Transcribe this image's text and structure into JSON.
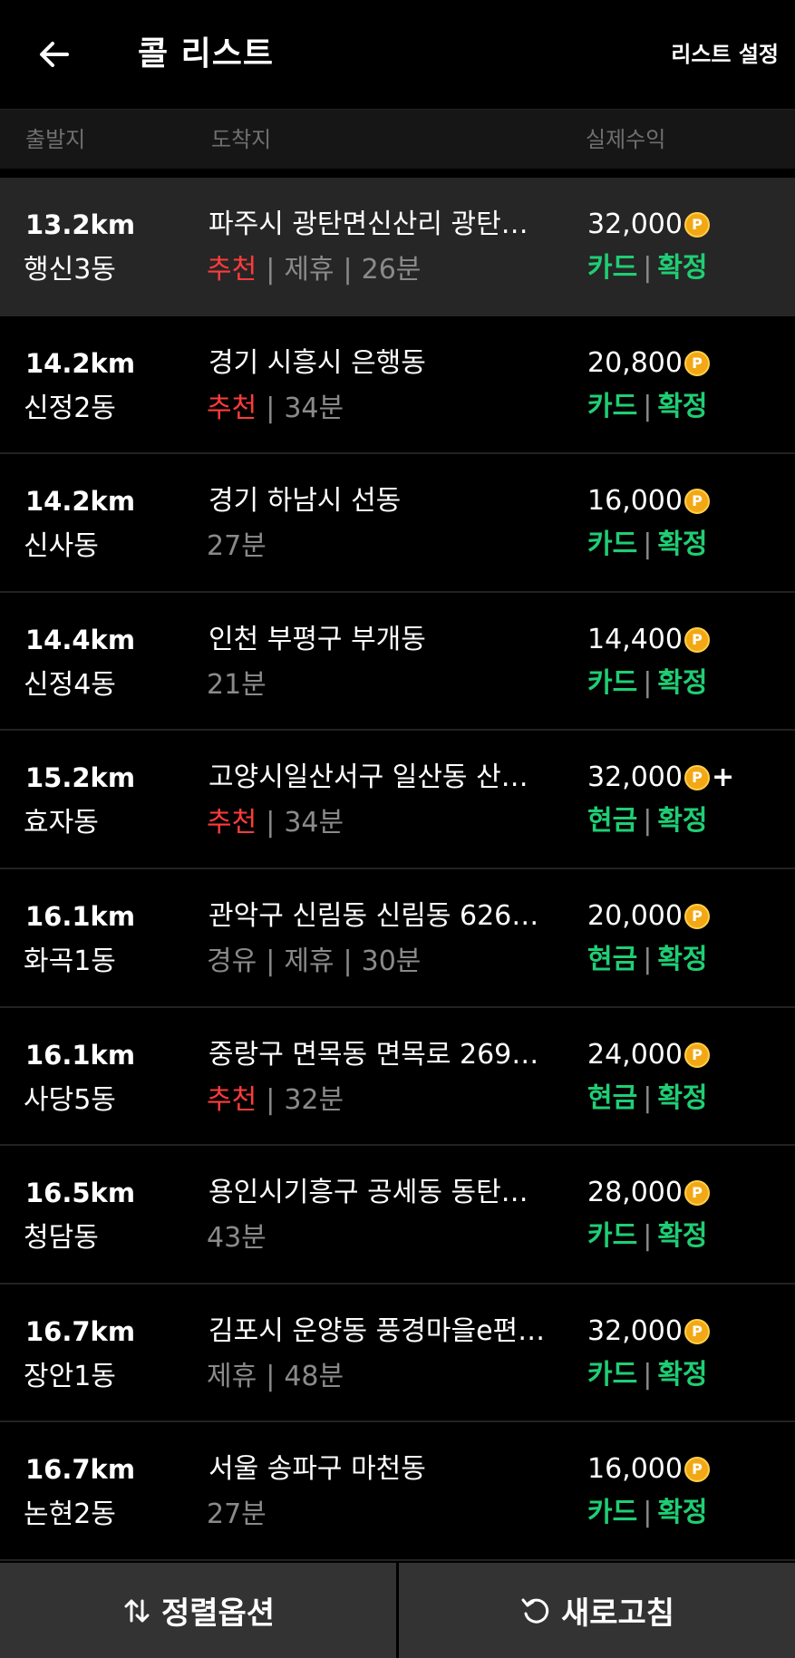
{
  "header": {
    "title": "콜 리스트",
    "settings_label": "리스트 설정"
  },
  "columns": {
    "origin": "출발지",
    "destination": "도착지",
    "earnings": "실제수익"
  },
  "rows": [
    {
      "distance": "13.2km",
      "origin": "행신3동",
      "destination": "파주시 광탄면신산리 광탄…",
      "recommend": "추천",
      "tags": [
        "제휴"
      ],
      "time": "26분",
      "price": "32,000",
      "plus": "",
      "payment": "카드",
      "status": "확정",
      "highlight": true
    },
    {
      "distance": "14.2km",
      "origin": "신정2동",
      "destination": "경기 시흥시 은행동",
      "recommend": "추천",
      "tags": [],
      "time": "34분",
      "price": "20,800",
      "plus": "",
      "payment": "카드",
      "status": "확정",
      "highlight": false
    },
    {
      "distance": "14.2km",
      "origin": "신사동",
      "destination": "경기 하남시 선동",
      "recommend": "",
      "tags": [],
      "time": "27분",
      "price": "16,000",
      "plus": "",
      "payment": "카드",
      "status": "확정",
      "highlight": false
    },
    {
      "distance": "14.4km",
      "origin": "신정4동",
      "destination": "인천 부평구 부개동",
      "recommend": "",
      "tags": [],
      "time": "21분",
      "price": "14,400",
      "plus": "",
      "payment": "카드",
      "status": "확정",
      "highlight": false
    },
    {
      "distance": "15.2km",
      "origin": "효자동",
      "destination": "고양시일산서구 일산동 산…",
      "recommend": "추천",
      "tags": [],
      "time": "34분",
      "price": "32,000",
      "plus": "+",
      "payment": "현금",
      "status": "확정",
      "highlight": false
    },
    {
      "distance": "16.1km",
      "origin": "화곡1동",
      "destination": "관악구 신림동 신림동 626…",
      "recommend": "",
      "tags": [
        "경유",
        "제휴"
      ],
      "time": "30분",
      "price": "20,000",
      "plus": "",
      "payment": "현금",
      "status": "확정",
      "highlight": false
    },
    {
      "distance": "16.1km",
      "origin": "사당5동",
      "destination": "중랑구 면목동 면목로 269…",
      "recommend": "추천",
      "tags": [],
      "time": "32분",
      "price": "24,000",
      "plus": "",
      "payment": "현금",
      "status": "확정",
      "highlight": false
    },
    {
      "distance": "16.5km",
      "origin": "청담동",
      "destination": "용인시기흥구 공세동 동탄…",
      "recommend": "",
      "tags": [],
      "time": "43분",
      "price": "28,000",
      "plus": "",
      "payment": "카드",
      "status": "확정",
      "highlight": false
    },
    {
      "distance": "16.7km",
      "origin": "장안1동",
      "destination": "김포시 운양동 풍경마을e편…",
      "recommend": "",
      "tags": [
        "제휴"
      ],
      "time": "48분",
      "price": "32,000",
      "plus": "",
      "payment": "카드",
      "status": "확정",
      "highlight": false
    },
    {
      "distance": "16.7km",
      "origin": "논현2동",
      "destination": "서울 송파구 마천동",
      "recommend": "",
      "tags": [],
      "time": "27분",
      "price": "16,000",
      "plus": "",
      "payment": "카드",
      "status": "확정",
      "highlight": false
    }
  ],
  "coin_symbol": "P",
  "separator": "|",
  "footer": {
    "sort_label": "정렬옵션",
    "refresh_label": "새로고침"
  },
  "colors": {
    "recommend": "#ff3b3b",
    "payment_green": "#1fce74",
    "coin": "#f2a815"
  },
  "icons": [
    "back-arrow-icon",
    "coin-icon",
    "sort-arrows-icon",
    "refresh-icon"
  ]
}
